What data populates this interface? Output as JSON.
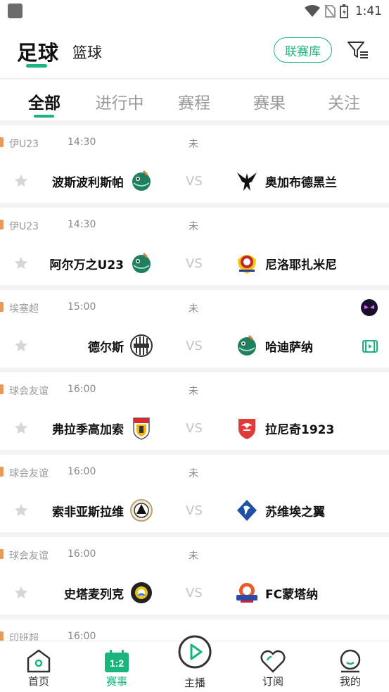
{
  "status_bar": {
    "time": "1:41"
  },
  "header": {
    "sport_tabs": [
      "足球",
      "篮球"
    ],
    "league_button": "联赛库"
  },
  "tabs": [
    "全部",
    "进行中",
    "赛程",
    "赛果",
    "关注"
  ],
  "matches": [
    {
      "league": "伊U23",
      "time": "14:30",
      "status": "未",
      "home": "波斯波利斯帕",
      "vs": "VS",
      "away": "奥加布德黑兰"
    },
    {
      "league": "伊U23",
      "time": "14:30",
      "status": "未",
      "home": "阿尔万之U23",
      "vs": "VS",
      "away": "尼洛耶扎米尼"
    },
    {
      "league": "埃塞超",
      "time": "15:00",
      "status": "未",
      "home": "德尔斯",
      "vs": "VS",
      "away": "哈迪萨纳"
    },
    {
      "league": "球会友谊",
      "time": "16:00",
      "status": "未",
      "home": "弗拉季高加索",
      "vs": "VS",
      "away": "拉尼奇1923"
    },
    {
      "league": "球会友谊",
      "time": "16:00",
      "status": "未",
      "home": "索非亚斯拉维",
      "vs": "VS",
      "away": "苏维埃之翼"
    },
    {
      "league": "球会友谊",
      "time": "16:00",
      "status": "未",
      "home": "史塔麦列克",
      "vs": "VS",
      "away": "FC蒙塔纳"
    },
    {
      "league": "印班超",
      "time": "16:00",
      "status": "",
      "home": "",
      "vs": "",
      "away": ""
    }
  ],
  "bottom_nav": [
    {
      "label": "首页",
      "icon": "home-icon"
    },
    {
      "label": "赛事",
      "icon": "scoreboard-icon",
      "badge": "1:2"
    },
    {
      "label": "主播",
      "icon": "play-icon"
    },
    {
      "label": "订阅",
      "icon": "heart-icon"
    },
    {
      "label": "我的",
      "icon": "profile-icon"
    }
  ],
  "colors": {
    "accent": "#19b57d",
    "league_marker": "#e99a5b"
  }
}
